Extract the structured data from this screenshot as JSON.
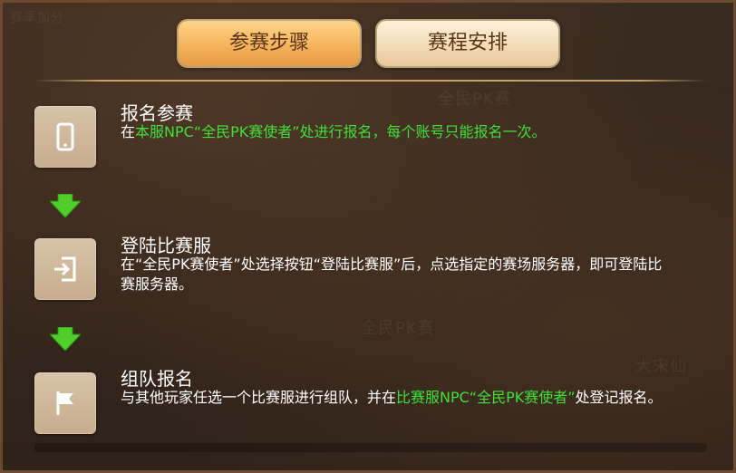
{
  "tabs": [
    {
      "label": "参赛步骤",
      "active": true
    },
    {
      "label": "赛程安排",
      "active": false
    }
  ],
  "background_text": [
    "全民PK赛",
    "全民PK赛",
    "大宋仙",
    "赛季加分"
  ],
  "steps": [
    {
      "title": "报名参赛",
      "icon": "phone-icon",
      "desc": [
        {
          "text": "在",
          "color": "white"
        },
        {
          "text": "本服NPC“全民PK赛使者”",
          "color": "green"
        },
        {
          "text": "处进行报名，每个账号只能报名一次。",
          "color": "green"
        }
      ]
    },
    {
      "title": "登陆比赛服",
      "icon": "login-icon",
      "desc": [
        {
          "text": "在“全民PK赛使者”处选择按钮“登陆比赛服”后，点选指定的赛场服务器，即可登陆比赛服务器。",
          "color": "white"
        }
      ]
    },
    {
      "title": "组队报名",
      "icon": "flag-icon",
      "desc": [
        {
          "text": "与其他玩家任选一个比赛服进行组队，并在",
          "color": "white"
        },
        {
          "text": "比赛服NPC“全民PK赛使者”",
          "color": "green"
        },
        {
          "text": "处登记报名。",
          "color": "white"
        }
      ]
    }
  ],
  "colors": {
    "accent_green": "#3fe03a",
    "tab_active": "#f5b35c",
    "tab_inactive": "#f2dbb6",
    "icon_tile": "#cfb89a"
  }
}
